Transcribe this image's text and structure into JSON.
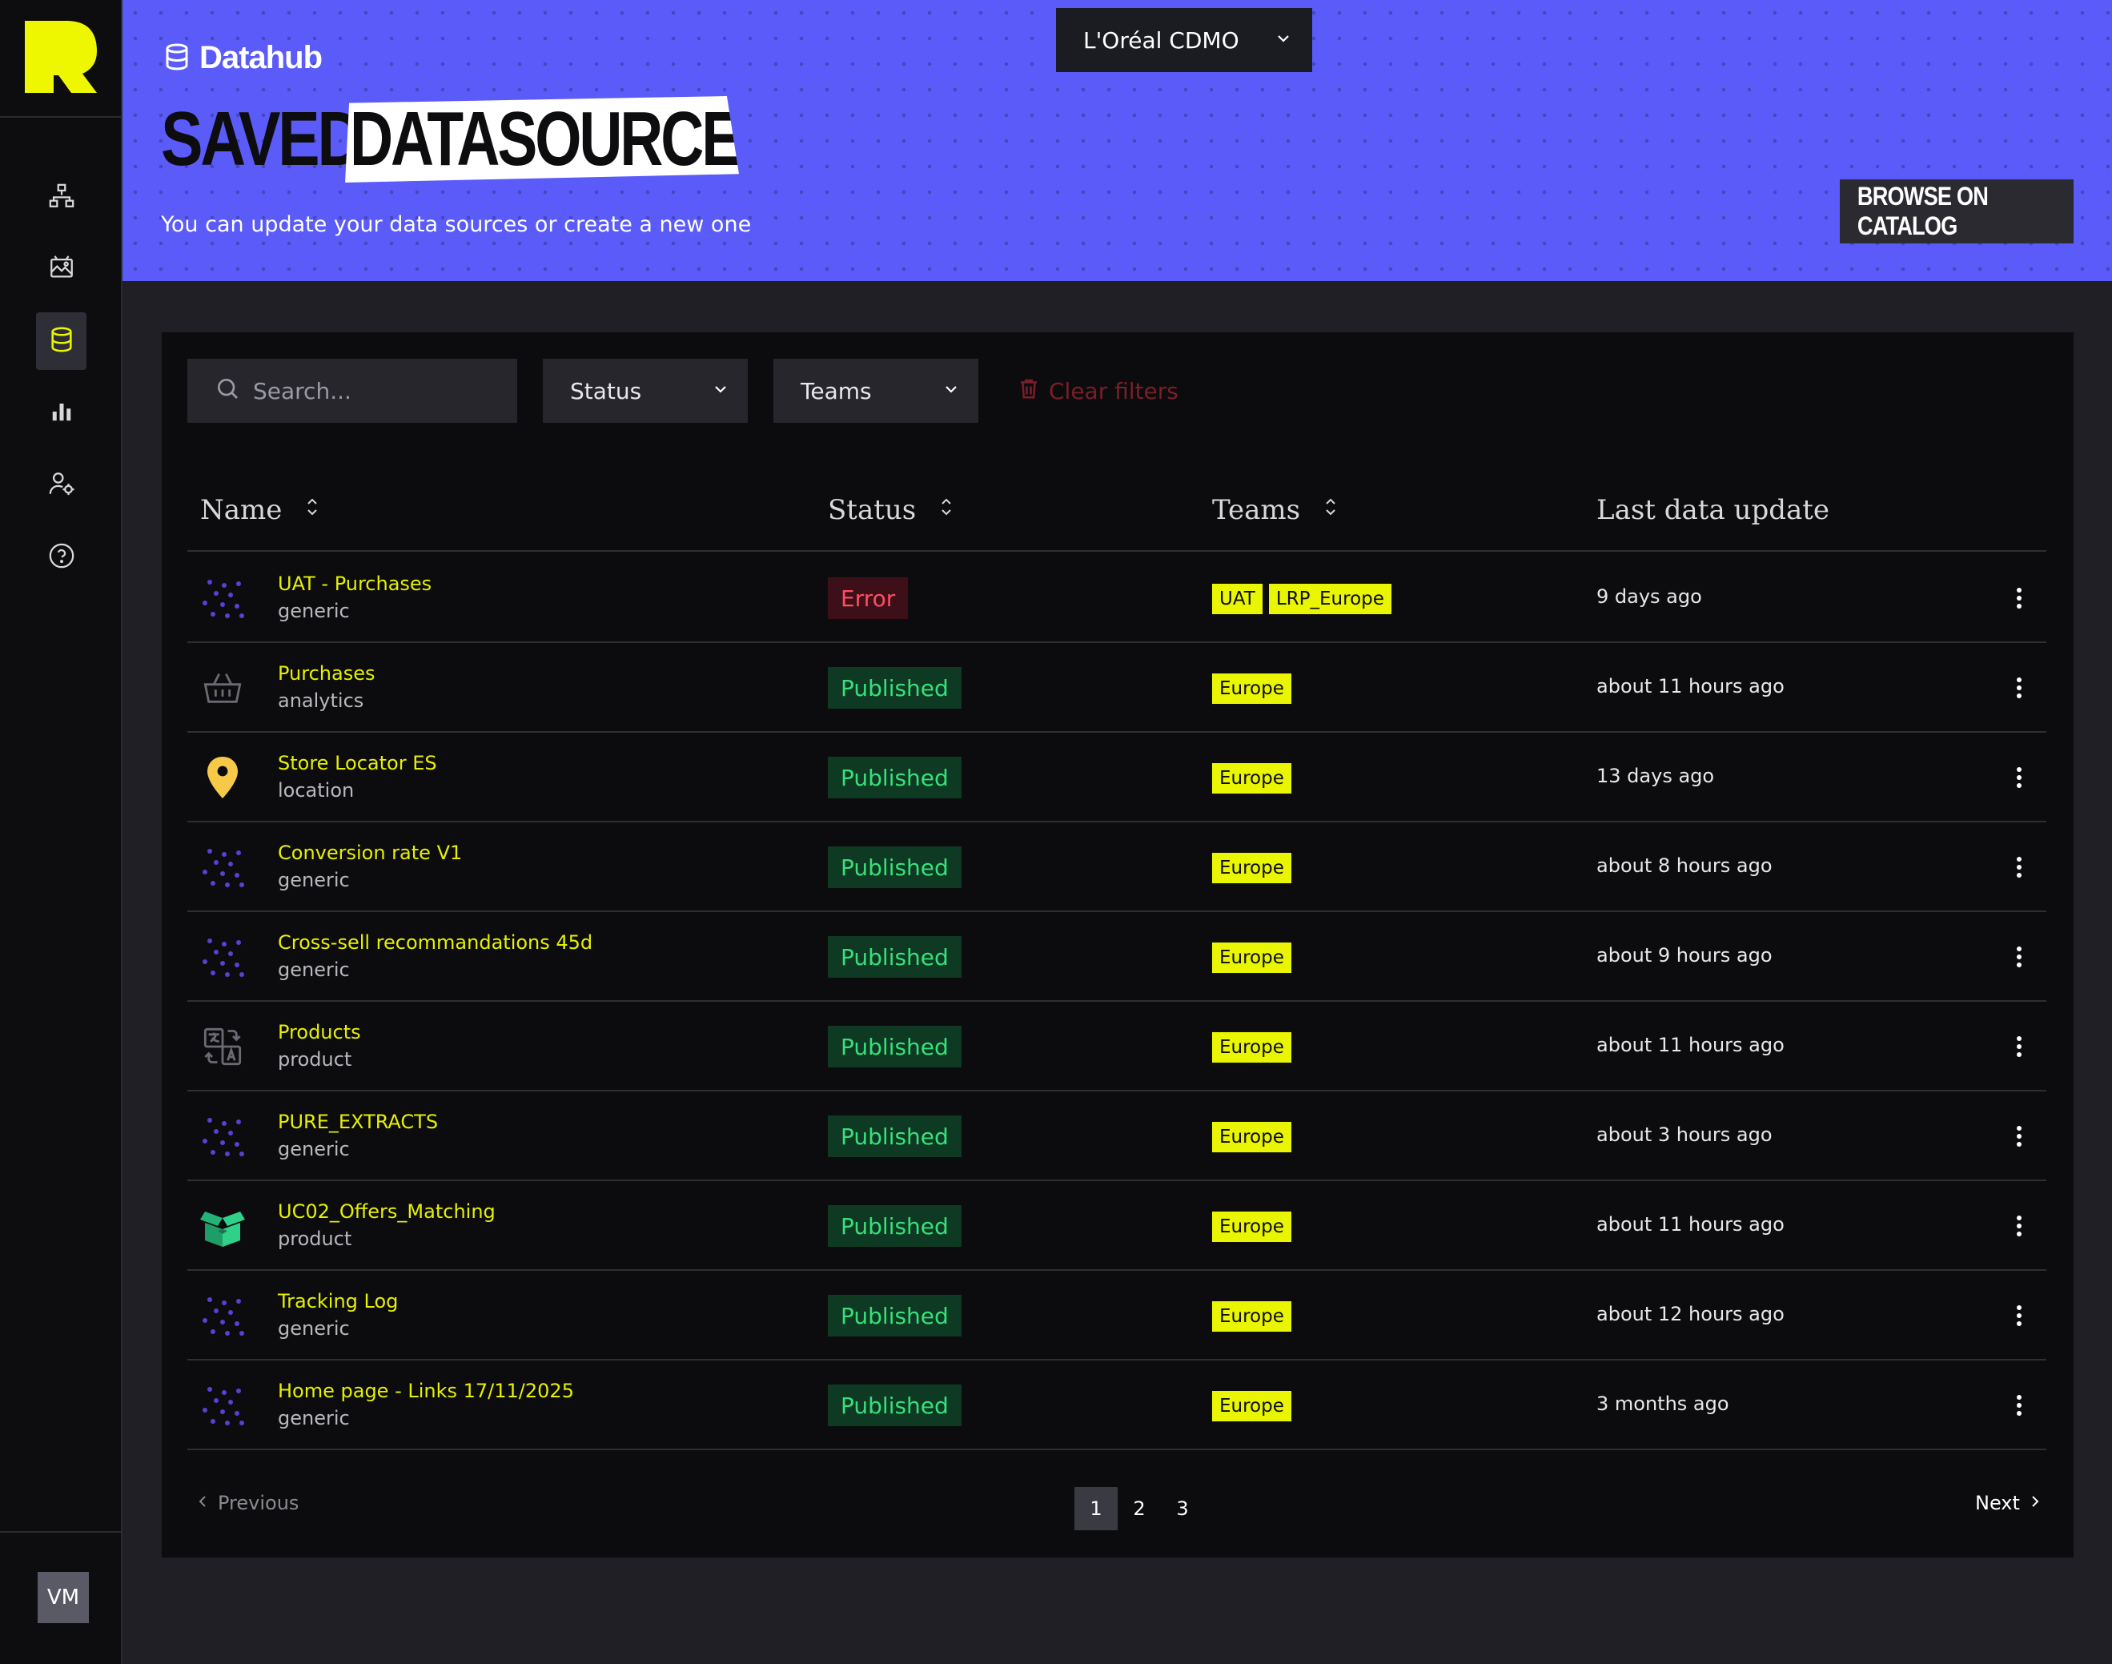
{
  "sidebar": {
    "logo": "brand-logo",
    "nav": [
      {
        "id": "hierarchy",
        "icon": "hierarchy-icon",
        "active": false
      },
      {
        "id": "gallery",
        "icon": "image-gallery-icon",
        "active": false
      },
      {
        "id": "datasources",
        "icon": "database-icon",
        "active": true
      },
      {
        "id": "analytics",
        "icon": "bar-chart-icon",
        "active": false
      },
      {
        "id": "users",
        "icon": "user-settings-icon",
        "active": false
      },
      {
        "id": "help",
        "icon": "help-circle-icon",
        "active": false
      }
    ],
    "avatar_initials": "VM"
  },
  "header": {
    "brand_label": "Datahub",
    "title_part1": "SAVED",
    "title_part2": "DATASOURCES",
    "subtitle": "You can update your data sources or create a new one",
    "org_select": "L'Oréal CDMO",
    "browse_button": "BROWSE ON CATALOG"
  },
  "filters": {
    "search_placeholder": "Search...",
    "status_label": "Status",
    "teams_label": "Teams",
    "clear_label": "Clear filters"
  },
  "table": {
    "columns": {
      "name": "Name",
      "status": "Status",
      "teams": "Teams",
      "last_update": "Last data update"
    },
    "rows": [
      {
        "name": "UAT - Purchases",
        "type": "generic",
        "icon": "dots-icon",
        "status": "Error",
        "teams": [
          "UAT",
          "LRP_Europe"
        ],
        "last_update": "9 days ago"
      },
      {
        "name": "Purchases",
        "type": "analytics",
        "icon": "basket-icon",
        "status": "Published",
        "teams": [
          "Europe"
        ],
        "last_update": "about 11 hours ago"
      },
      {
        "name": "Store Locator ES",
        "type": "location",
        "icon": "map-pin-icon",
        "status": "Published",
        "teams": [
          "Europe"
        ],
        "last_update": "13 days ago"
      },
      {
        "name": "Conversion rate V1",
        "type": "generic",
        "icon": "dots-icon",
        "status": "Published",
        "teams": [
          "Europe"
        ],
        "last_update": "about 8 hours ago"
      },
      {
        "name": "Cross-sell recommandations 45d",
        "type": "generic",
        "icon": "dots-icon",
        "status": "Published",
        "teams": [
          "Europe"
        ],
        "last_update": "about 9 hours ago"
      },
      {
        "name": "Products",
        "type": "product",
        "icon": "translate-icon",
        "status": "Published",
        "teams": [
          "Europe"
        ],
        "last_update": "about 11 hours ago"
      },
      {
        "name": "PURE_EXTRACTS",
        "type": "generic",
        "icon": "dots-icon",
        "status": "Published",
        "teams": [
          "Europe"
        ],
        "last_update": "about 3 hours ago"
      },
      {
        "name": "UC02_Offers_Matching",
        "type": "product",
        "icon": "open-box-icon",
        "status": "Published",
        "teams": [
          "Europe"
        ],
        "last_update": "about 11 hours ago"
      },
      {
        "name": "Tracking Log",
        "type": "generic",
        "icon": "dots-icon",
        "status": "Published",
        "teams": [
          "Europe"
        ],
        "last_update": "about 12 hours ago"
      },
      {
        "name": "Home page - Links 17/11/2025",
        "type": "generic",
        "icon": "dots-icon",
        "status": "Published",
        "teams": [
          "Europe"
        ],
        "last_update": "3 months ago"
      }
    ]
  },
  "pagination": {
    "previous": "Previous",
    "next": "Next",
    "pages": [
      "1",
      "2",
      "3"
    ],
    "current": "1"
  },
  "colors": {
    "header_bg": "#5b5bfa",
    "accent_yellow": "#eaf600",
    "published_fg": "#37e07a",
    "error_fg": "#ff4d62"
  }
}
